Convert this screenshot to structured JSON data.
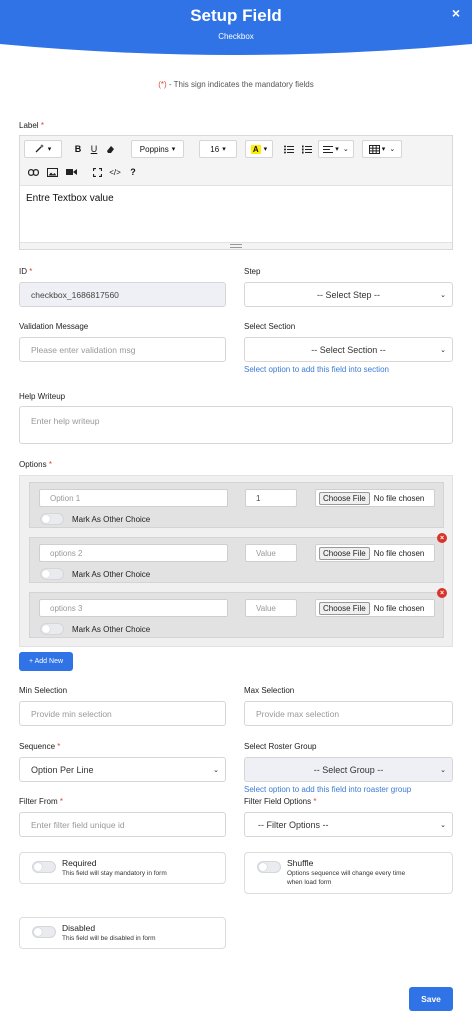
{
  "header": {
    "title": "Setup Field",
    "subtitle": "Checkbox",
    "close": "×",
    "color": "#2f73e6"
  },
  "notice": {
    "sign": "(*)",
    "text": " - This sign indicates the mandatory fields"
  },
  "label": {
    "title": "Label",
    "star": "*",
    "toolbar": {
      "font": "Poppins",
      "size": "16",
      "bold": "B",
      "underline": "U",
      "code": "</>",
      "help": "?",
      "highlight": "A"
    },
    "content": "Entre Textbox value"
  },
  "id_field": {
    "label": "ID",
    "star": "*",
    "value": "checkbox_1686817560"
  },
  "step": {
    "label": "Step",
    "value": "-- Select Step --"
  },
  "validation": {
    "label": "Validation Message",
    "placeholder": "Please enter validation msg"
  },
  "section": {
    "label": "Select Section",
    "value": "-- Select Section --",
    "hint": "Select option to add this field into section"
  },
  "help": {
    "label": "Help Writeup",
    "placeholder": "Enter help writeup"
  },
  "options": {
    "label": "Options",
    "star": "*",
    "items": [
      {
        "name": "Option 1",
        "value": "1",
        "file_button": "Choose File",
        "file_status": "No file chosen",
        "other_label": "Mark As Other Choice"
      },
      {
        "name": "options 2",
        "value": "Value",
        "file_button": "Choose File",
        "file_status": "No file chosen",
        "other_label": "Mark As Other Choice"
      },
      {
        "name": "options 3",
        "value": "Value",
        "file_button": "Choose File",
        "file_status": "No file chosen",
        "other_label": "Mark As Other Choice"
      }
    ],
    "add_label": "+ Add New"
  },
  "min_selection": {
    "label": "Min Selection",
    "placeholder": "Provide min selection"
  },
  "max_selection": {
    "label": "Max Selection",
    "placeholder": "Provide max selection"
  },
  "sequence": {
    "label": "Sequence",
    "star": "*",
    "value": "Option Per Line"
  },
  "roster": {
    "label": "Select Roster Group",
    "value": "-- Select Group --",
    "hint": "Select option to add this field into roaster group"
  },
  "filter_from": {
    "label": "Filter From",
    "star": "*",
    "placeholder": "Enter filter field unique id"
  },
  "filter_options": {
    "label": "Filter Field Options",
    "star": "*",
    "value": "-- Filter Options --"
  },
  "required": {
    "title": "Required",
    "desc": "This field will stay mandatory in form"
  },
  "shuffle": {
    "title": "Shuffle",
    "desc1": "Options sequence will change every time",
    "desc2": "when load form"
  },
  "disabled": {
    "title": "Disabled",
    "desc": "This field will be disabled in form"
  },
  "save_label": "Save"
}
